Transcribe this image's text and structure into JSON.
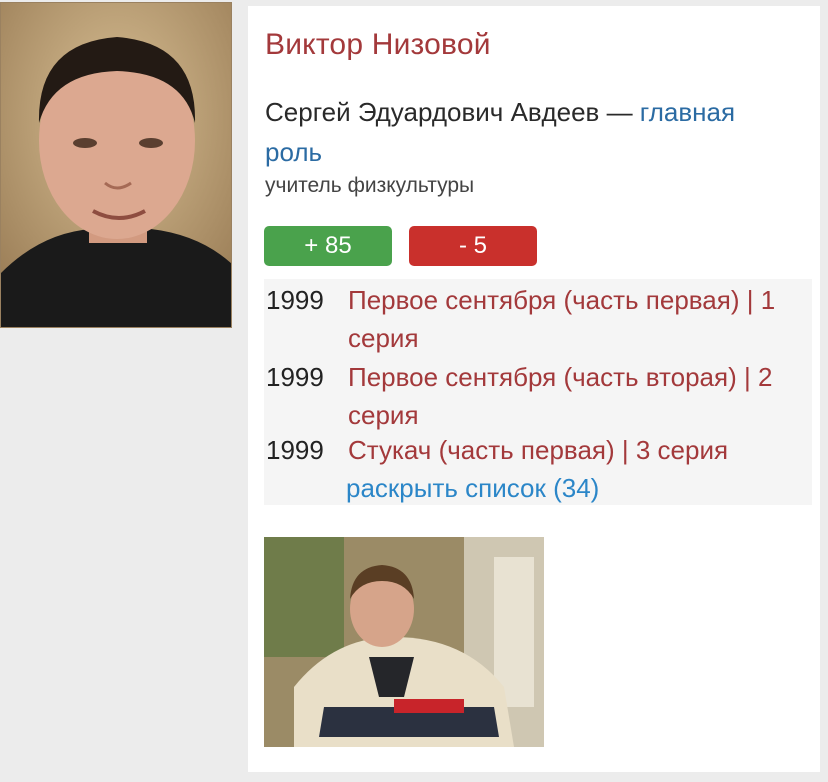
{
  "character": {
    "name": "Виктор Низовой",
    "actor": "Сергей Эдуардович Авдеев",
    "dash": " — ",
    "role_type": "главная роль",
    "description": "учитель физкультуры"
  },
  "votes": {
    "up": "+ 85",
    "down": "- 5"
  },
  "films": [
    {
      "year": "1999",
      "title": "Первое сентября (часть первая) | 1 серия"
    },
    {
      "year": "1999",
      "title": "Первое сентября (часть вторая) | 2 серия"
    },
    {
      "year": "1999",
      "title": "Стукач (часть первая) | 3 серия"
    }
  ],
  "expand_link": "раскрыть список (34)",
  "colors": {
    "accent_red": "#a3393b",
    "link_blue": "#2b6ba3",
    "vote_up": "#4aa24c",
    "vote_down": "#c9302c"
  }
}
